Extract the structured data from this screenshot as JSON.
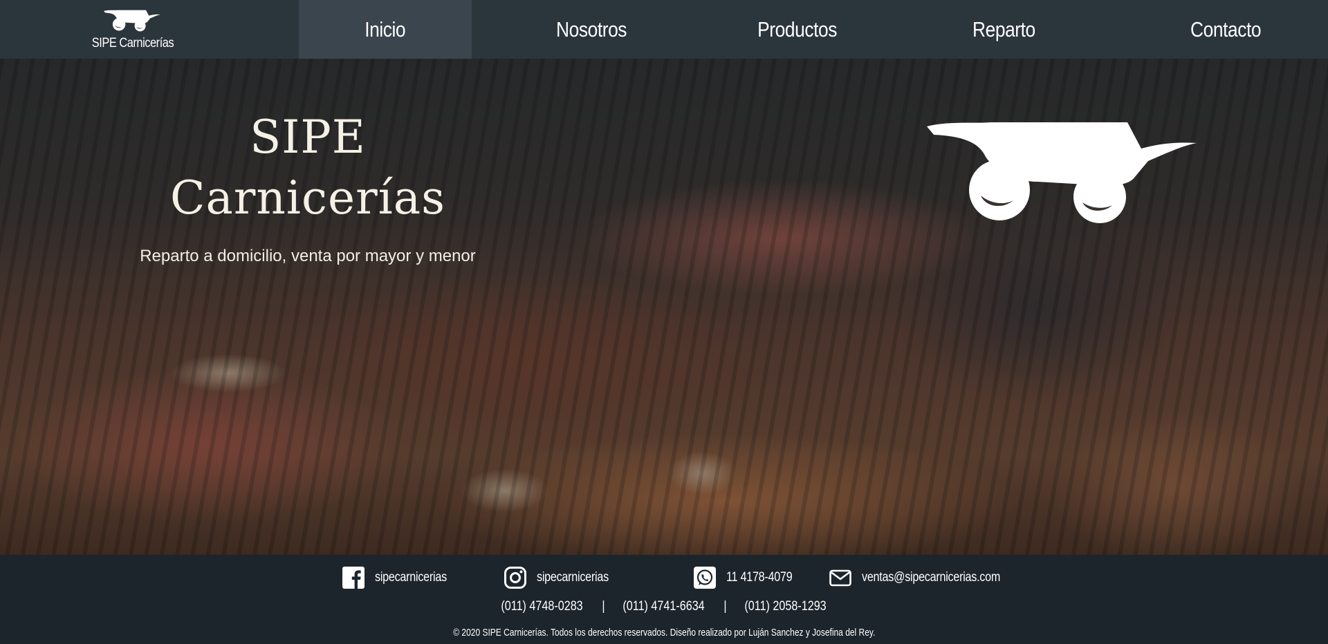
{
  "nav": {
    "brand_name": "SIPE Carnicerías",
    "items": [
      {
        "label": "Inicio",
        "active": true
      },
      {
        "label": "Nosotros",
        "active": false
      },
      {
        "label": "Productos",
        "active": false
      },
      {
        "label": "Reparto",
        "active": false
      },
      {
        "label": "Contacto",
        "active": false
      }
    ]
  },
  "hero": {
    "title_line1": "SIPE",
    "title_line2": "Carnicerías",
    "subtitle": "Reparto a domicilio, venta por mayor y menor"
  },
  "footer": {
    "social": [
      {
        "icon": "facebook-icon",
        "label": "sipecarnicerias"
      },
      {
        "icon": "instagram-icon",
        "label": "sipecarnicerias"
      },
      {
        "icon": "whatsapp-icon",
        "label": "11 4178-4079"
      },
      {
        "icon": "mail-icon",
        "label": "ventas@sipecarnicerias.com"
      }
    ],
    "phones": [
      "(011) 4748-0283",
      "(011) 4741-6634",
      "(011) 2058-1293"
    ],
    "separator": "|",
    "copyright": "© 2020 SIPE Carnicerías. Todos los derechos reservados.  Diseño realizado por Luján Sanchez y Josefina del Rey."
  },
  "colors": {
    "nav_bg": "#2b353c",
    "nav_active_bg": "#3a454d",
    "footer_bg": "#1c252b",
    "text": "#ffffff"
  }
}
